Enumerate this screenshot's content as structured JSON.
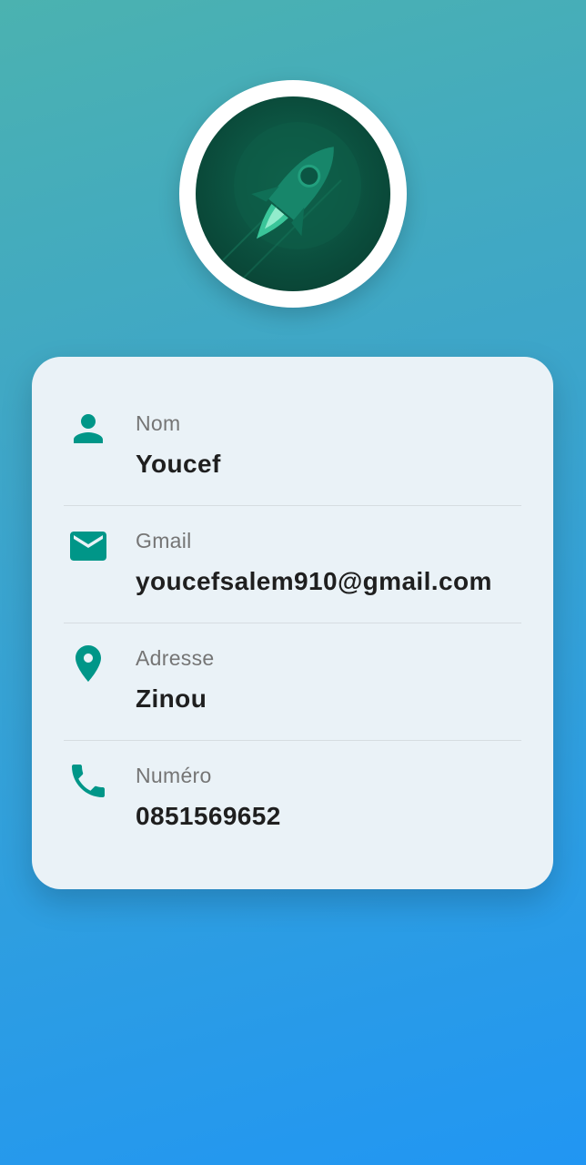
{
  "profile": {
    "avatar_icon": "rocket-icon"
  },
  "info": [
    {
      "label": "Nom",
      "value": "Youcef",
      "icon": "person-icon"
    },
    {
      "label": "Gmail",
      "value": "youcefsalem910@gmail.com",
      "icon": "mail-icon"
    },
    {
      "label": "Adresse",
      "value": "Zinou",
      "icon": "location-pin-icon"
    },
    {
      "label": "Numéro",
      "value": "0851569652",
      "icon": "phone-icon"
    }
  ],
  "colors": {
    "accent": "#009688",
    "background_start": "#4bb2b0",
    "background_end": "#2196f3",
    "card": "#eaf2f7"
  }
}
